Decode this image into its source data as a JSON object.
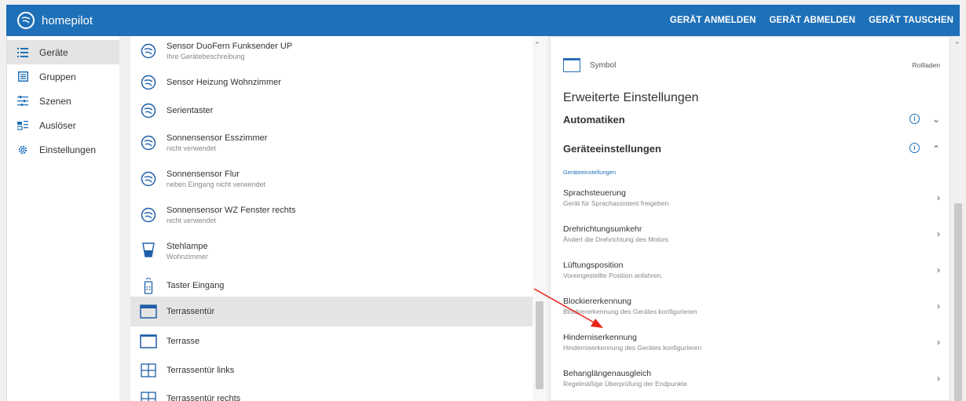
{
  "app": {
    "name": "homepilot",
    "actions": [
      "GERÄT ANMELDEN",
      "GERÄT ABMELDEN",
      "GERÄT TAUSCHEN"
    ]
  },
  "sidebar": {
    "items": [
      {
        "label": "Geräte",
        "icon": "list-icon",
        "active": true
      },
      {
        "label": "Gruppen",
        "icon": "group-icon",
        "active": false
      },
      {
        "label": "Szenen",
        "icon": "sliders-icon",
        "active": false
      },
      {
        "label": "Auslöser",
        "icon": "trigger-icon",
        "active": false
      },
      {
        "label": "Einstellungen",
        "icon": "gear-icon",
        "active": false
      }
    ]
  },
  "devices": [
    {
      "title": "Sensor DuoFern Funksender UP",
      "sub": "Ihre Gerätebeschreibung",
      "icon": "sensor-icon"
    },
    {
      "title": "Sensor Heizung Wohnzimmer",
      "sub": "",
      "icon": "sensor-icon"
    },
    {
      "title": "Serientaster",
      "sub": "",
      "icon": "sensor-icon"
    },
    {
      "title": "Sonnensensor Esszimmer",
      "sub": "nicht verwendet",
      "icon": "sensor-icon"
    },
    {
      "title": "Sonnensensor Flur",
      "sub": "neben Eingang nicht verwendet",
      "icon": "sensor-icon"
    },
    {
      "title": "Sonnensensor WZ Fenster rechts",
      "sub": "nicht verwendet",
      "icon": "sensor-icon"
    },
    {
      "title": "Stehlampe",
      "sub": "Wohnzimmer",
      "icon": "lamp-icon"
    },
    {
      "title": "Taster Eingang",
      "sub": "",
      "icon": "remote-icon"
    },
    {
      "title": "Terrassentür",
      "sub": "",
      "icon": "shutter-icon",
      "active": true
    },
    {
      "title": "Terrasse",
      "sub": "",
      "icon": "window-icon"
    },
    {
      "title": "Terrassentür links",
      "sub": "",
      "icon": "grid-window-icon"
    },
    {
      "title": "Terrassentür rechts",
      "sub": "",
      "icon": "grid-window-icon"
    }
  ],
  "detail": {
    "symbol_label": "Symbol",
    "symbol_value": "Rollladen",
    "advanced_heading": "Erweiterte Einstellungen",
    "automatics": "Automatiken",
    "device_settings": "Geräteeinstellungen",
    "device_settings_small": "Geräteeinstellungen",
    "settings": [
      {
        "title": "Sprachsteuerung",
        "sub": "Gerät für Sprachassistent freigeben"
      },
      {
        "title": "Drehrichtungsumkehr",
        "sub": "Ändert die Drehrichtung des Motors"
      },
      {
        "title": "Lüftungsposition",
        "sub": "Voreingestellte Position anfahren."
      },
      {
        "title": "Blockiererkennung",
        "sub": "Blockiererkennung des Gerätes konfigurieren"
      },
      {
        "title": "Hinderniserkennung",
        "sub": "Hinderniserkennung des Gerätes konfigurieren"
      },
      {
        "title": "Behanglängenausgleich",
        "sub": "Regelmäßige Überprüfung der Endpunkte"
      }
    ]
  },
  "colors": {
    "brand": "#1e70b8",
    "annotation_arrow": "#e8231a"
  }
}
